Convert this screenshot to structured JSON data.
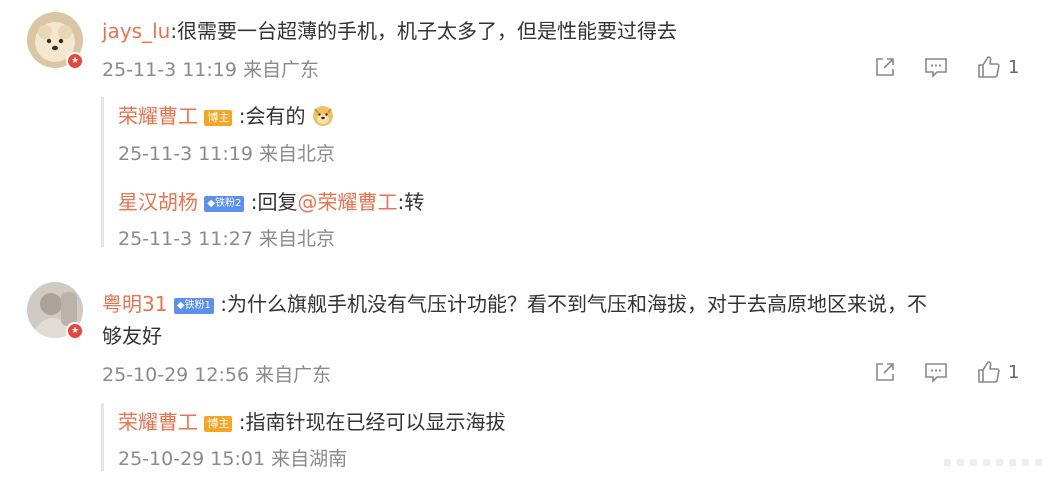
{
  "colors": {
    "username": "#eb7350",
    "text": "#333333",
    "meta": "#8a8a8a",
    "host_tag": "#f6a623",
    "fan_tag": "#5b8ff0",
    "icon": "#888888"
  },
  "comments": [
    {
      "user": "jays_lu",
      "separator": ":",
      "text": "很需要一台超薄的手机，机子太多了，但是性能要过得去",
      "time": "25-11-3 11:19",
      "location": "来自广东",
      "likes": "1",
      "replies": [
        {
          "user": "荣耀曹工",
          "badge": "博主",
          "separator": ":",
          "text": "会有的",
          "emoji": "doge-emoji",
          "time": "25-11-3 11:19",
          "location": "来自北京"
        },
        {
          "user": "星汉胡杨",
          "badge": "铁粉2",
          "separator": ":",
          "prefix": "回复",
          "mention": "@荣耀曹工",
          "separator2": ":",
          "text": "转",
          "time": "25-11-3 11:27",
          "location": "来自北京"
        }
      ]
    },
    {
      "user": "粤明31",
      "badge": "铁粉1",
      "separator": ":",
      "text_line1": "为什么旗舰手机没有气压计功能？看不到气压和海拔，对于去高原地区来说，不",
      "text_line2": "够友好",
      "time": "25-10-29 12:56",
      "location": "来自广东",
      "likes": "1",
      "replies": [
        {
          "user": "荣耀曹工",
          "badge": "博主",
          "separator": ":",
          "text": "指南针现在已经可以显示海拔",
          "time": "25-10-29 15:01",
          "location": "来自湖南"
        }
      ]
    }
  ],
  "icons": {
    "share": "share-icon",
    "comment": "comment-icon",
    "like": "like-icon"
  }
}
